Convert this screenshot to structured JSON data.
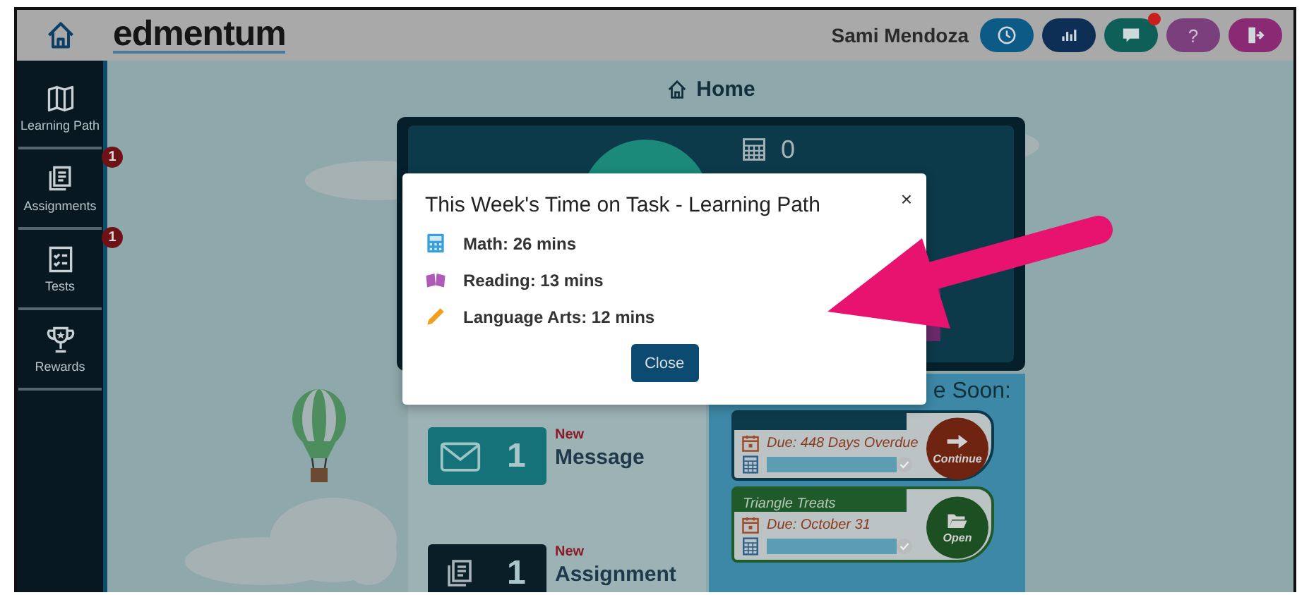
{
  "header": {
    "logo": "edmentum",
    "user_name": "Sami Mendoza",
    "buttons": [
      {
        "kind": "clock",
        "notification": false
      },
      {
        "kind": "chart",
        "notification": false
      },
      {
        "kind": "chat",
        "notification": true
      },
      {
        "kind": "help",
        "label": "?",
        "notification": false
      },
      {
        "kind": "exit",
        "notification": false
      }
    ]
  },
  "sidebar": {
    "items": [
      {
        "kind": "map",
        "label": "Learning Path"
      },
      {
        "kind": "assignments",
        "label": "Assignments",
        "badge": "1"
      },
      {
        "kind": "tests",
        "label": "Tests",
        "badge": "1"
      },
      {
        "kind": "rewards",
        "label": "Rewards"
      }
    ]
  },
  "page_title": "Home",
  "dashboard": {
    "counter": "0"
  },
  "tiles": [
    {
      "kind": "message",
      "count": "1",
      "tag": "New",
      "label": "Message"
    },
    {
      "kind": "assignment",
      "count": "1",
      "tag": "New",
      "label": "Assignment"
    }
  ],
  "due_soon": {
    "heading": "e Soon:",
    "cards": [
      {
        "kind": "continue",
        "due": "Due: 448 Days Overdue",
        "level": 1,
        "action": "Continue"
      },
      {
        "kind": "open",
        "title": "Triangle Treats",
        "due": "Due: October 31",
        "level": 1,
        "action": "Open"
      }
    ]
  },
  "modal": {
    "title": "This Week's Time on Task - Learning Path",
    "close_icon": "×",
    "rows": [
      {
        "kind": "math",
        "text": "Math: 26 mins"
      },
      {
        "kind": "reading",
        "text": "Reading: 13 mins"
      },
      {
        "kind": "language",
        "text": "Language Arts: 12 mins"
      }
    ],
    "button": "Close"
  }
}
